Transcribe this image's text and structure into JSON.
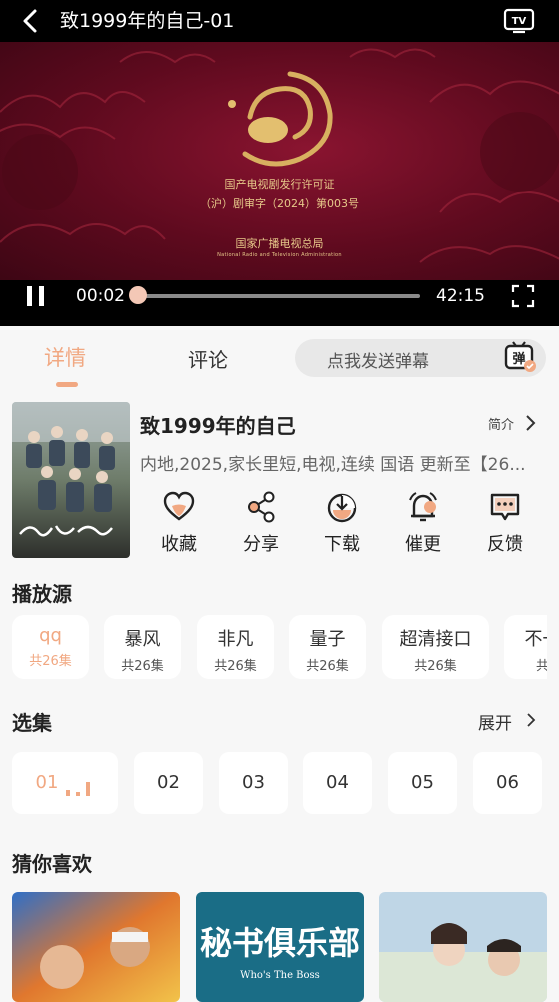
{
  "header": {
    "title": "致1999年的自己-01"
  },
  "video": {
    "license_line1": "国产电视剧发行许可证",
    "license_line2": "（沪）剧审字（2024）第003号",
    "authority": "国家广播电视总局",
    "authority_en": "National Radio and Television Administration"
  },
  "player": {
    "current_time": "00:02",
    "duration": "42:15",
    "progress": 0.001
  },
  "tabs": {
    "detail": "详情",
    "comments": "评论",
    "danmaku_placeholder": "点我发送弹幕"
  },
  "show": {
    "title": "致1999年的自己",
    "intro_label": "简介",
    "meta": "内地,2025,家长里短,电视,连续 国语 更新至【26...",
    "actions": [
      {
        "label": "收藏",
        "icon": "heart-icon"
      },
      {
        "label": "分享",
        "icon": "share-icon"
      },
      {
        "label": "下载",
        "icon": "download-icon"
      },
      {
        "label": "催更",
        "icon": "bell-icon"
      },
      {
        "label": "反馈",
        "icon": "feedback-icon"
      }
    ]
  },
  "sources": {
    "title": "播放源",
    "items": [
      {
        "name": "qq",
        "count": "共26集"
      },
      {
        "name": "暴风",
        "count": "共26集"
      },
      {
        "name": "非凡",
        "count": "共26集"
      },
      {
        "name": "量子",
        "count": "共26集"
      },
      {
        "name": "超清接口",
        "count": "共26集"
      },
      {
        "name": "不一",
        "count": "共"
      }
    ]
  },
  "episodes": {
    "title": "选集",
    "expand_label": "展开",
    "items": [
      "01",
      "02",
      "03",
      "04",
      "05",
      "06"
    ]
  },
  "recommend": {
    "title": "猜你喜欢",
    "items": [
      {
        "image_text": ""
      },
      {
        "image_text": "秘书俱乐部",
        "image_subtext": "Who's The Boss"
      },
      {
        "image_text": ""
      }
    ]
  },
  "colors": {
    "accent": "#f1a882",
    "video_bg": "#6a0d22",
    "gold": "#e7c98a"
  }
}
